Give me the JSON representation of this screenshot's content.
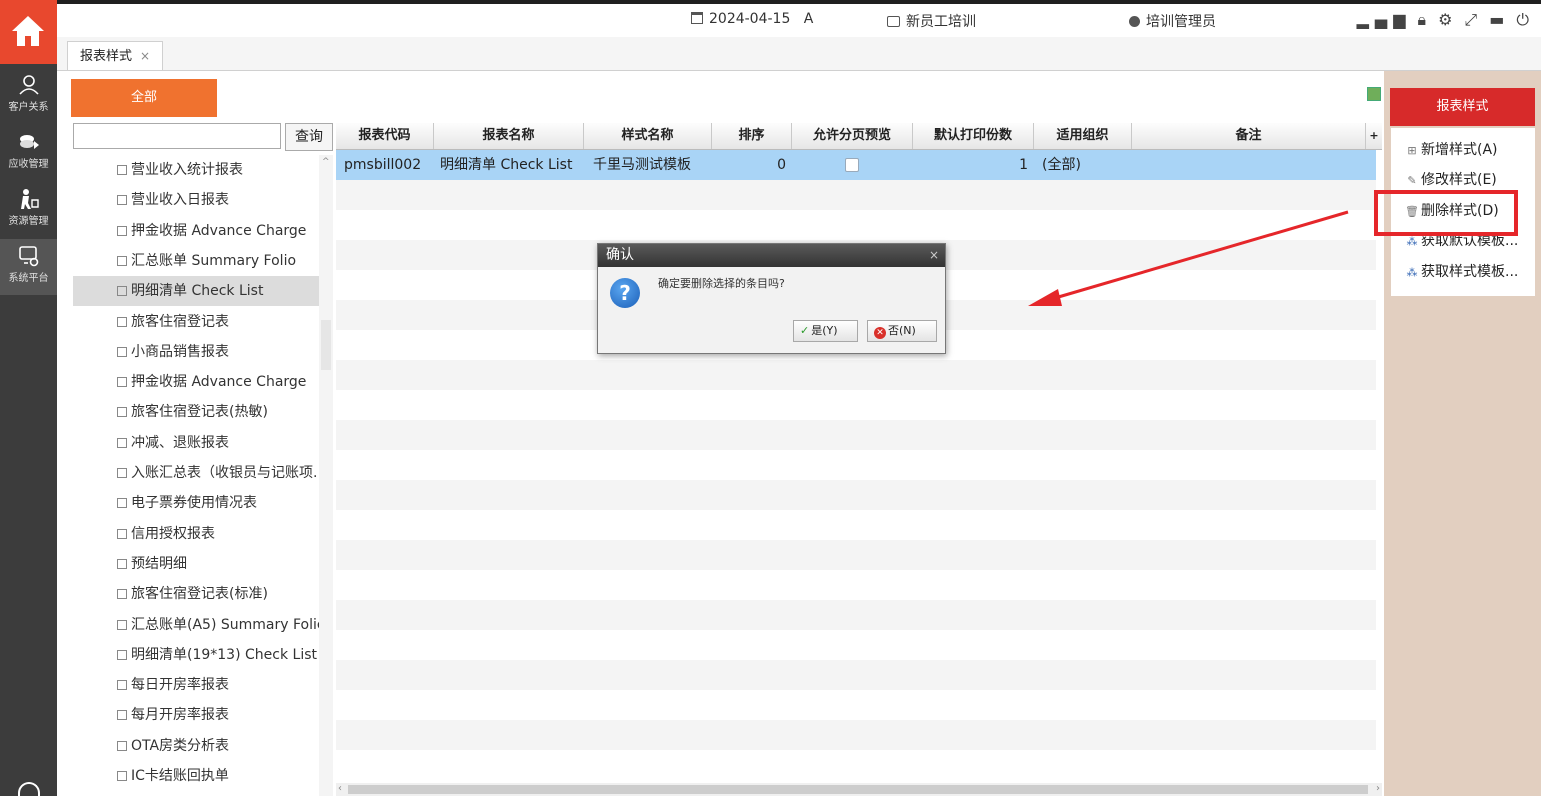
{
  "header": {
    "date": "2024-04-15",
    "shift": "A",
    "hotel": "新员工培训",
    "user": "培训管理员"
  },
  "leftnav": {
    "items": [
      "客户关系",
      "应收管理",
      "资源管理",
      "系统平台"
    ]
  },
  "tab": {
    "label": "报表样式",
    "close": "×"
  },
  "main": {
    "all_button": "全部",
    "search": {
      "value": "",
      "button": "查询"
    },
    "tree": [
      "营业收入统计报表",
      "营业收入日报表",
      "押金收据 Advance Charge",
      "汇总账单 Summary Folio",
      "明细清单 Check List",
      "旅客住宿登记表",
      "小商品销售报表",
      "押金收据 Advance Charge",
      "旅客住宿登记表(热敏)",
      "冲减、退账报表",
      "入账汇总表（收银员与记账项.",
      "电子票券使用情况表",
      "信用授权报表",
      "预结明细",
      "旅客住宿登记表(标准)",
      "汇总账单(A5) Summary Folic",
      "明细清单(19*13) Check List",
      "每日开房率报表",
      "每月开房率报表",
      "OTA房类分析表",
      "IC卡结账回执单"
    ],
    "grid": {
      "columns": [
        "报表代码",
        "报表名称",
        "样式名称",
        "排序",
        "允许分页预览",
        "默认打印份数",
        "适用组织",
        "备注"
      ],
      "rows": [
        {
          "code": "pmsbill002",
          "name": "明细清单  Check List",
          "style": "千里马测试模板",
          "order": "0",
          "paging": false,
          "copies": "1",
          "org": "(全部)",
          "remark": ""
        }
      ]
    }
  },
  "rpanel": {
    "title": "报表样式",
    "items": [
      "新增样式(A)",
      "修改样式(E)",
      "删除样式(D)",
      "获取默认模板...",
      "获取样式模板..."
    ]
  },
  "dialog": {
    "title": "确认",
    "close": "×",
    "message": "确定要删除选择的条目吗?",
    "yes": "是(Y)",
    "no": "否(N)"
  }
}
